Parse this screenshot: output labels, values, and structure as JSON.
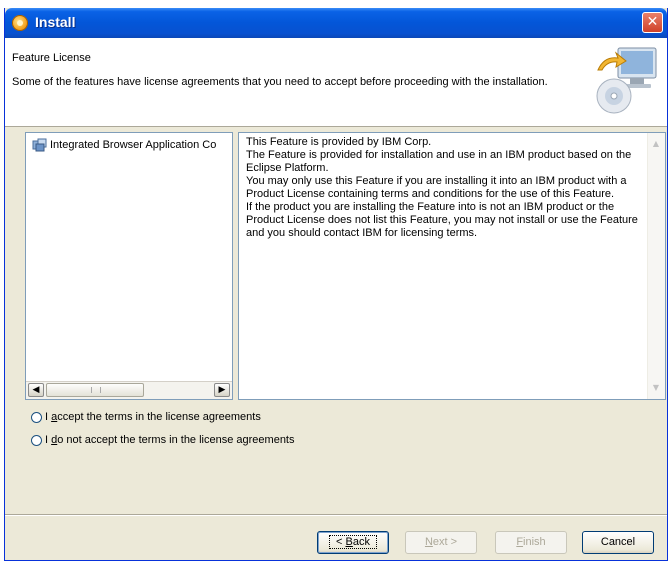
{
  "window": {
    "title": "Install",
    "close_glyph": "✕"
  },
  "header": {
    "title": "Feature License",
    "description": "Some of the features have license agreements that you need to accept before proceeding with the installation."
  },
  "features": {
    "items": [
      {
        "label": "Integrated Browser Application Co"
      }
    ]
  },
  "license": {
    "text": "This Feature is provided by IBM Corp.\nThe Feature is provided for installation and use in an IBM product based on the Eclipse Platform.\nYou may only use this Feature if you are installing it into an IBM product with a Product License containing terms and conditions for the use of this Feature.\nIf the product you are installing the Feature into is not an IBM product or the Product License does not list this Feature, you may not install or use the Feature and you should contact IBM for licensing terms."
  },
  "options": {
    "accept_prefix": "I ",
    "accept_mnemonic": "a",
    "accept_rest": "ccept the terms in the license agreements",
    "decline_prefix": "I ",
    "decline_mnemonic": "d",
    "decline_rest": "o not accept the terms in the license agreements"
  },
  "buttons": {
    "back_prefix": "< ",
    "back_mnemonic": "B",
    "back_rest": "ack",
    "next_mnemonic": "N",
    "next_rest": "ext >",
    "finish_mnemonic": "F",
    "finish_rest": "inish",
    "cancel": "Cancel"
  },
  "colors": {
    "titlebar": "#0356d8",
    "dialog_bg": "#ece9d8",
    "border": "#7f9db9"
  }
}
